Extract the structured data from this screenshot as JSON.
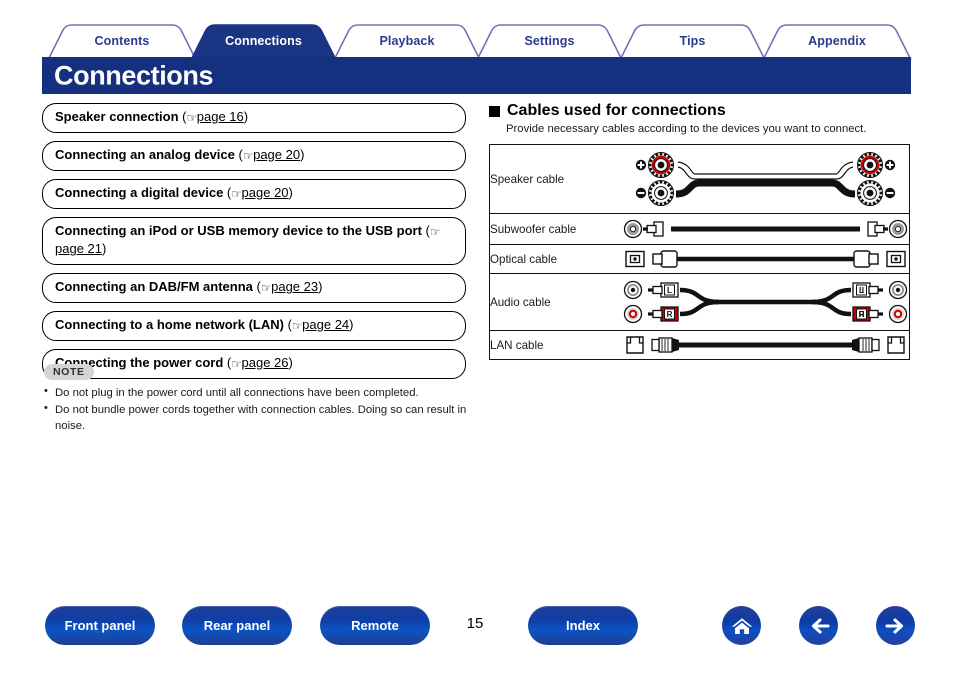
{
  "tabs": [
    {
      "label": "Contents",
      "active": false
    },
    {
      "label": "Connections",
      "active": true
    },
    {
      "label": "Playback",
      "active": false
    },
    {
      "label": "Settings",
      "active": false
    },
    {
      "label": "Tips",
      "active": false
    },
    {
      "label": "Appendix",
      "active": false
    }
  ],
  "header": {
    "title": "Connections",
    "bar_color": "#14307f",
    "tab_text_color": "#2b3a8f"
  },
  "left_column": {
    "links": [
      {
        "title": "Speaker connection",
        "ref": "page 16"
      },
      {
        "title": "Connecting an analog device",
        "ref": "page 20"
      },
      {
        "title": "Connecting a digital device",
        "ref": "page 20"
      },
      {
        "title": "Connecting an iPod or USB memory device to the USB port",
        "ref": "page 21"
      },
      {
        "title": "Connecting an DAB/FM antenna",
        "ref": "page 23"
      },
      {
        "title": "Connecting to a home network (LAN)",
        "ref": "page 24"
      },
      {
        "title": "Connecting the power cord",
        "ref": "page 26"
      }
    ],
    "note": {
      "badge": "NOTE",
      "items": [
        "Do not plug in the power cord until all connections have been completed.",
        "Do not bundle power cords together with connection cables. Doing so can result in noise."
      ]
    }
  },
  "right_column": {
    "section_title": "Cables used for connections",
    "section_subtitle": "Provide necessary cables according to the devices you want to connect.",
    "table": {
      "rows": [
        {
          "label": "Speaker cable",
          "art": "speaker"
        },
        {
          "label": "Subwoofer cable",
          "art": "subwoofer"
        },
        {
          "label": "Optical cable",
          "art": "optical"
        },
        {
          "label": "Audio cable",
          "art": "audio"
        },
        {
          "label": "LAN cable",
          "art": "lan"
        }
      ]
    },
    "colors": {
      "positive_terminal": "#cc0000",
      "negative_terminal": "#000000",
      "right_channel": "#cc0000"
    }
  },
  "bottom_nav": {
    "buttons": [
      {
        "label": "Front panel"
      },
      {
        "label": "Rear panel"
      },
      {
        "label": "Remote"
      },
      {
        "label": "Index"
      }
    ],
    "page_number": "15",
    "icons": [
      {
        "name": "home-icon"
      },
      {
        "name": "arrow-left-icon"
      },
      {
        "name": "arrow-right-icon"
      }
    ],
    "button_color": "#0f3fa8"
  }
}
